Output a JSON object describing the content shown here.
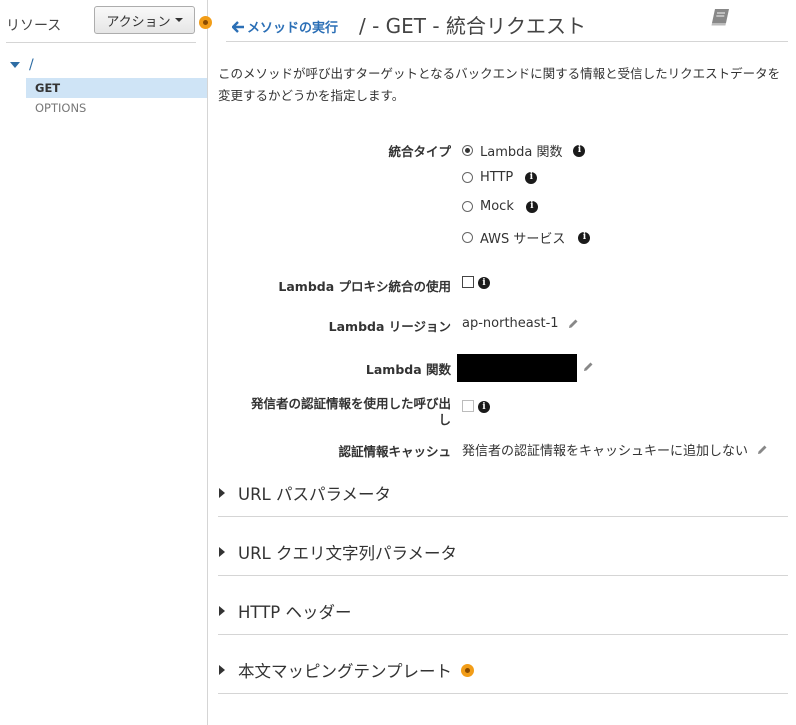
{
  "sidebar": {
    "resources_label": "リソース",
    "actions_label": "アクション",
    "tree_root": "/",
    "methods": [
      "GET",
      "OPTIONS"
    ]
  },
  "header": {
    "back_label": "メソッドの実行",
    "title": "/ - GET - 統合リクエスト"
  },
  "description": "このメソッドが呼び出すターゲットとなるバックエンドに関する情報と受信したリクエストデータを変更するかどうかを指定します。",
  "form": {
    "integration_type_label": "統合タイプ",
    "integration_options": [
      "Lambda 関数",
      "HTTP",
      "Mock",
      "AWS サービス"
    ],
    "integration_selected": "Lambda 関数",
    "proxy_label": "Lambda プロキシ統合の使用",
    "proxy_checked": false,
    "region_label": "Lambda リージョン",
    "region_value": "ap-northeast-1",
    "function_label": "Lambda 関数",
    "caller_credentials_label_line1": "発信者の認証情報を使用した呼び出",
    "caller_credentials_label_line2": "し",
    "caller_credentials_checked": false,
    "cache_label": "認証情報キャッシュ",
    "cache_value": "発信者の認証情報をキャッシュキーに追加しない"
  },
  "sections": [
    "URL パスパラメータ",
    "URL クエリ文字列パラメータ",
    "HTTP ヘッダー",
    "本文マッピングテンプレート"
  ],
  "colors": {
    "link_blue": "#2b6fb6",
    "selected_row": "#cfe4f6",
    "indicator_orange": "#f29d18"
  }
}
